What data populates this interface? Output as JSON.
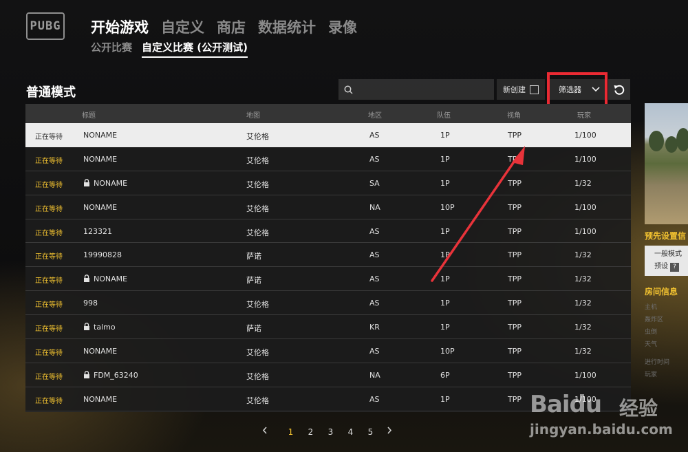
{
  "header": {
    "logo_text": "PUBG",
    "main_nav": [
      "开始游戏",
      "自定义",
      "商店",
      "数据统计",
      "录像"
    ],
    "sub_nav": [
      "公开比赛",
      "自定义比赛 (公开测试)"
    ]
  },
  "toolbar": {
    "section_title": "普通模式",
    "search_placeholder": "",
    "new_created_label": "新创建",
    "filter_label": "筛选器"
  },
  "table": {
    "columns": [
      "标题",
      "地图",
      "地区",
      "队伍",
      "视角",
      "玩家"
    ],
    "rows": [
      {
        "status": "正在等待",
        "title": "NONAME",
        "locked": false,
        "map": "艾伦格",
        "region": "AS",
        "team": "1P",
        "view": "TPP",
        "players": "1/100"
      },
      {
        "status": "正在等待",
        "title": "NONAME",
        "locked": false,
        "map": "艾伦格",
        "region": "AS",
        "team": "1P",
        "view": "TPP",
        "players": "1/100"
      },
      {
        "status": "正在等待",
        "title": "NONAME",
        "locked": true,
        "map": "艾伦格",
        "region": "SA",
        "team": "1P",
        "view": "TPP",
        "players": "1/32"
      },
      {
        "status": "正在等待",
        "title": "NONAME",
        "locked": false,
        "map": "艾伦格",
        "region": "NA",
        "team": "10P",
        "view": "TPP",
        "players": "1/100"
      },
      {
        "status": "正在等待",
        "title": "123321",
        "locked": false,
        "map": "艾伦格",
        "region": "AS",
        "team": "1P",
        "view": "TPP",
        "players": "1/100"
      },
      {
        "status": "正在等待",
        "title": "19990828",
        "locked": false,
        "map": "萨诺",
        "region": "AS",
        "team": "1P",
        "view": "TPP",
        "players": "1/32"
      },
      {
        "status": "正在等待",
        "title": "NONAME",
        "locked": true,
        "map": "萨诺",
        "region": "AS",
        "team": "1P",
        "view": "TPP",
        "players": "1/32"
      },
      {
        "status": "正在等待",
        "title": "998",
        "locked": false,
        "map": "艾伦格",
        "region": "AS",
        "team": "1P",
        "view": "TPP",
        "players": "1/32"
      },
      {
        "status": "正在等待",
        "title": "talmo",
        "locked": true,
        "map": "萨诺",
        "region": "KR",
        "team": "1P",
        "view": "TPP",
        "players": "1/32"
      },
      {
        "status": "正在等待",
        "title": "NONAME",
        "locked": false,
        "map": "艾伦格",
        "region": "AS",
        "team": "10P",
        "view": "TPP",
        "players": "1/32"
      },
      {
        "status": "正在等待",
        "title": "FDM_63240",
        "locked": true,
        "map": "艾伦格",
        "region": "NA",
        "team": "6P",
        "view": "TPP",
        "players": "1/100"
      },
      {
        "status": "正在等待",
        "title": "NONAME",
        "locked": false,
        "map": "艾伦格",
        "region": "AS",
        "team": "1P",
        "view": "TPP",
        "players": "1/100"
      }
    ]
  },
  "pagination": {
    "prev_icon": "chevron-left-icon",
    "pages": [
      "1",
      "2",
      "3",
      "4",
      "5"
    ],
    "current": "1",
    "next_icon": "chevron-right-icon"
  },
  "right_panel": {
    "preset_heading": "预先设置信",
    "preset_mode": "一般模式",
    "preset_label": "预设",
    "preset_help": "?",
    "room_heading": "房间信息",
    "room_fields": [
      "主机",
      "轰炸区",
      "虫倒",
      "天气",
      "进行时间",
      "玩家"
    ]
  },
  "watermark": {
    "brand": "Baidu",
    "brand_cn": "经验",
    "url": "jingyan.baidu.com"
  },
  "colors": {
    "status_waiting": "#f2c230",
    "highlight_box": "#ea2a33",
    "selected_row": "#ededed"
  }
}
